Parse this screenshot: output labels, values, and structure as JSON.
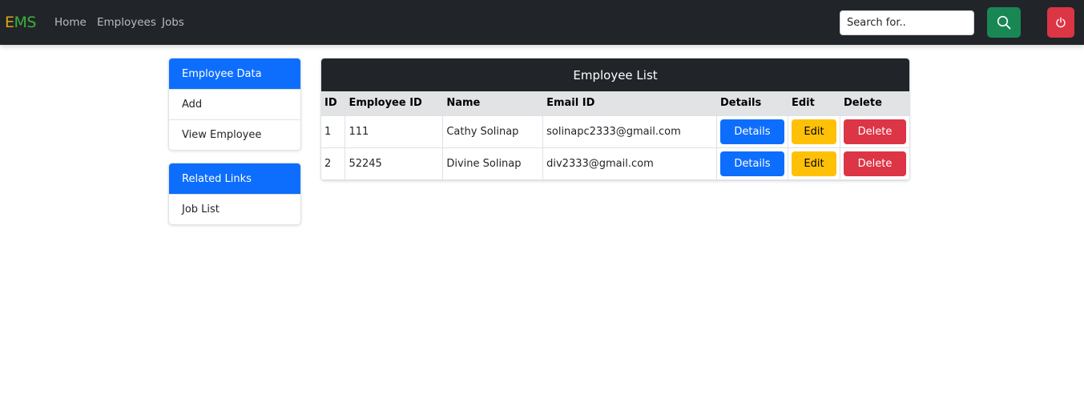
{
  "navbar": {
    "brand_part1": "E",
    "brand_part2": "MS",
    "links": [
      "Home",
      "Employees",
      "Jobs"
    ],
    "search_placeholder": "Search for..",
    "colors": {
      "background": "#212529",
      "brand_e": "#e0a412",
      "brand_ms": "#3bb03b",
      "search_button": "#198754",
      "logout_button": "#dc3545"
    }
  },
  "sidebar": {
    "employee_group": {
      "title": "Employee Data",
      "items": [
        "Add",
        "View Employee"
      ]
    },
    "links_group": {
      "title": "Related Links",
      "items": [
        "Job List"
      ]
    },
    "accent": "#0d6efd"
  },
  "employee_list": {
    "title": "Employee List",
    "columns": [
      "ID",
      "Employee ID",
      "Name",
      "Email ID",
      "Details",
      "Edit",
      "Delete"
    ],
    "rows": [
      {
        "id": "1",
        "employee_id": "111",
        "name": "Cathy Solinap",
        "email": "solinapc2333@gmail.com"
      },
      {
        "id": "2",
        "employee_id": "52245",
        "name": "Divine Solinap",
        "email": "div2333@gmail.com"
      }
    ],
    "actions": {
      "details": "Details",
      "edit": "Edit",
      "delete": "Delete"
    }
  },
  "icons": {
    "search": "search-icon",
    "power": "power-icon"
  }
}
